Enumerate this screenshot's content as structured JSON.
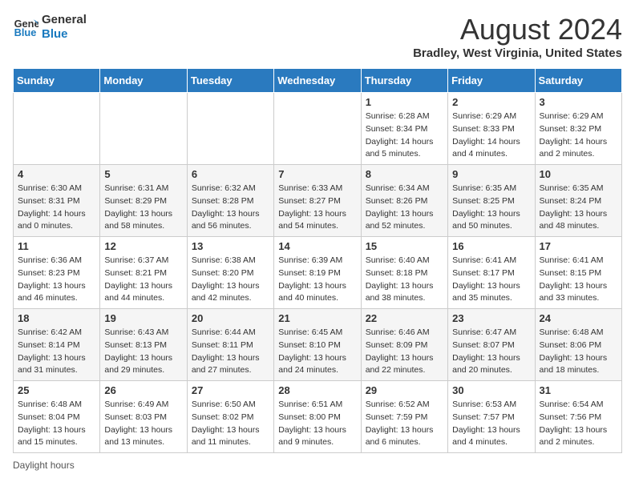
{
  "logo": {
    "line1": "General",
    "line2": "Blue"
  },
  "header": {
    "title": "August 2024",
    "location": "Bradley, West Virginia, United States"
  },
  "weekdays": [
    "Sunday",
    "Monday",
    "Tuesday",
    "Wednesday",
    "Thursday",
    "Friday",
    "Saturday"
  ],
  "weeks": [
    [
      {
        "day": "",
        "info": ""
      },
      {
        "day": "",
        "info": ""
      },
      {
        "day": "",
        "info": ""
      },
      {
        "day": "",
        "info": ""
      },
      {
        "day": "1",
        "info": "Sunrise: 6:28 AM\nSunset: 8:34 PM\nDaylight: 14 hours and 5 minutes."
      },
      {
        "day": "2",
        "info": "Sunrise: 6:29 AM\nSunset: 8:33 PM\nDaylight: 14 hours and 4 minutes."
      },
      {
        "day": "3",
        "info": "Sunrise: 6:29 AM\nSunset: 8:32 PM\nDaylight: 14 hours and 2 minutes."
      }
    ],
    [
      {
        "day": "4",
        "info": "Sunrise: 6:30 AM\nSunset: 8:31 PM\nDaylight: 14 hours and 0 minutes."
      },
      {
        "day": "5",
        "info": "Sunrise: 6:31 AM\nSunset: 8:29 PM\nDaylight: 13 hours and 58 minutes."
      },
      {
        "day": "6",
        "info": "Sunrise: 6:32 AM\nSunset: 8:28 PM\nDaylight: 13 hours and 56 minutes."
      },
      {
        "day": "7",
        "info": "Sunrise: 6:33 AM\nSunset: 8:27 PM\nDaylight: 13 hours and 54 minutes."
      },
      {
        "day": "8",
        "info": "Sunrise: 6:34 AM\nSunset: 8:26 PM\nDaylight: 13 hours and 52 minutes."
      },
      {
        "day": "9",
        "info": "Sunrise: 6:35 AM\nSunset: 8:25 PM\nDaylight: 13 hours and 50 minutes."
      },
      {
        "day": "10",
        "info": "Sunrise: 6:35 AM\nSunset: 8:24 PM\nDaylight: 13 hours and 48 minutes."
      }
    ],
    [
      {
        "day": "11",
        "info": "Sunrise: 6:36 AM\nSunset: 8:23 PM\nDaylight: 13 hours and 46 minutes."
      },
      {
        "day": "12",
        "info": "Sunrise: 6:37 AM\nSunset: 8:21 PM\nDaylight: 13 hours and 44 minutes."
      },
      {
        "day": "13",
        "info": "Sunrise: 6:38 AM\nSunset: 8:20 PM\nDaylight: 13 hours and 42 minutes."
      },
      {
        "day": "14",
        "info": "Sunrise: 6:39 AM\nSunset: 8:19 PM\nDaylight: 13 hours and 40 minutes."
      },
      {
        "day": "15",
        "info": "Sunrise: 6:40 AM\nSunset: 8:18 PM\nDaylight: 13 hours and 38 minutes."
      },
      {
        "day": "16",
        "info": "Sunrise: 6:41 AM\nSunset: 8:17 PM\nDaylight: 13 hours and 35 minutes."
      },
      {
        "day": "17",
        "info": "Sunrise: 6:41 AM\nSunset: 8:15 PM\nDaylight: 13 hours and 33 minutes."
      }
    ],
    [
      {
        "day": "18",
        "info": "Sunrise: 6:42 AM\nSunset: 8:14 PM\nDaylight: 13 hours and 31 minutes."
      },
      {
        "day": "19",
        "info": "Sunrise: 6:43 AM\nSunset: 8:13 PM\nDaylight: 13 hours and 29 minutes."
      },
      {
        "day": "20",
        "info": "Sunrise: 6:44 AM\nSunset: 8:11 PM\nDaylight: 13 hours and 27 minutes."
      },
      {
        "day": "21",
        "info": "Sunrise: 6:45 AM\nSunset: 8:10 PM\nDaylight: 13 hours and 24 minutes."
      },
      {
        "day": "22",
        "info": "Sunrise: 6:46 AM\nSunset: 8:09 PM\nDaylight: 13 hours and 22 minutes."
      },
      {
        "day": "23",
        "info": "Sunrise: 6:47 AM\nSunset: 8:07 PM\nDaylight: 13 hours and 20 minutes."
      },
      {
        "day": "24",
        "info": "Sunrise: 6:48 AM\nSunset: 8:06 PM\nDaylight: 13 hours and 18 minutes."
      }
    ],
    [
      {
        "day": "25",
        "info": "Sunrise: 6:48 AM\nSunset: 8:04 PM\nDaylight: 13 hours and 15 minutes."
      },
      {
        "day": "26",
        "info": "Sunrise: 6:49 AM\nSunset: 8:03 PM\nDaylight: 13 hours and 13 minutes."
      },
      {
        "day": "27",
        "info": "Sunrise: 6:50 AM\nSunset: 8:02 PM\nDaylight: 13 hours and 11 minutes."
      },
      {
        "day": "28",
        "info": "Sunrise: 6:51 AM\nSunset: 8:00 PM\nDaylight: 13 hours and 9 minutes."
      },
      {
        "day": "29",
        "info": "Sunrise: 6:52 AM\nSunset: 7:59 PM\nDaylight: 13 hours and 6 minutes."
      },
      {
        "day": "30",
        "info": "Sunrise: 6:53 AM\nSunset: 7:57 PM\nDaylight: 13 hours and 4 minutes."
      },
      {
        "day": "31",
        "info": "Sunrise: 6:54 AM\nSunset: 7:56 PM\nDaylight: 13 hours and 2 minutes."
      }
    ]
  ],
  "footer": {
    "note": "Daylight hours"
  }
}
